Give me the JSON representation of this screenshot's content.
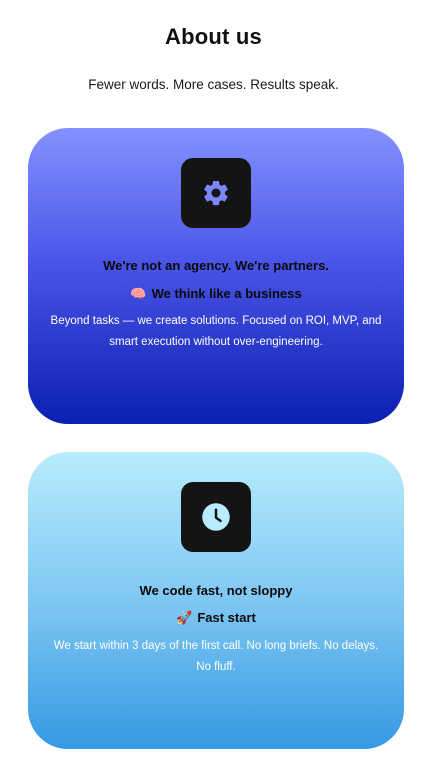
{
  "page": {
    "title": "About us",
    "subtitle": "Fewer words. More cases. Results speak."
  },
  "cards": [
    {
      "icon": "gear-icon",
      "heading": "We're not an agency. We're partners.",
      "sub_emoji": "🧠",
      "sub_heading": "We think like a business",
      "body": "Beyond tasks — we create solutions. Focused on ROI, MVP, and smart execution without over-engineering.",
      "icon_color": "#7b86ff"
    },
    {
      "icon": "clock-icon",
      "heading": "We code fast, not sloppy",
      "sub_emoji": "🚀",
      "sub_heading": "Fast start",
      "body": "We start within 3 days of the first call. No long briefs. No delays. No fluff.",
      "icon_color": "#b8ecfc"
    }
  ]
}
